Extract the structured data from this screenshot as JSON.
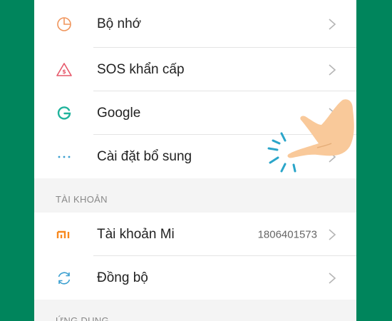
{
  "settings_group_1": [
    {
      "label": "Bộ nhớ",
      "icon": "storage-pie-icon",
      "color": "#f0955c"
    },
    {
      "label": "SOS khẩn cấp",
      "icon": "sos-warning-icon",
      "color": "#e6586a"
    },
    {
      "label": "Google",
      "icon": "google-g-icon",
      "color": "#20b39c"
    },
    {
      "label": "Cài đặt bổ sung",
      "icon": "more-dots-icon",
      "color": "#3a9fd0"
    }
  ],
  "accounts_section": {
    "header": "TÀI KHOẢN",
    "items": [
      {
        "label": "Tài khoản Mi",
        "value": "1806401573",
        "icon": "mi-logo-icon",
        "color": "#f7891f"
      },
      {
        "label": "Đồng bộ",
        "icon": "sync-icon",
        "color": "#3a9fd0"
      }
    ]
  },
  "apps_section": {
    "header": "ỨNG DỤNG"
  },
  "colors": {
    "background_frame": "#00855c",
    "accent": "#f7891f"
  }
}
